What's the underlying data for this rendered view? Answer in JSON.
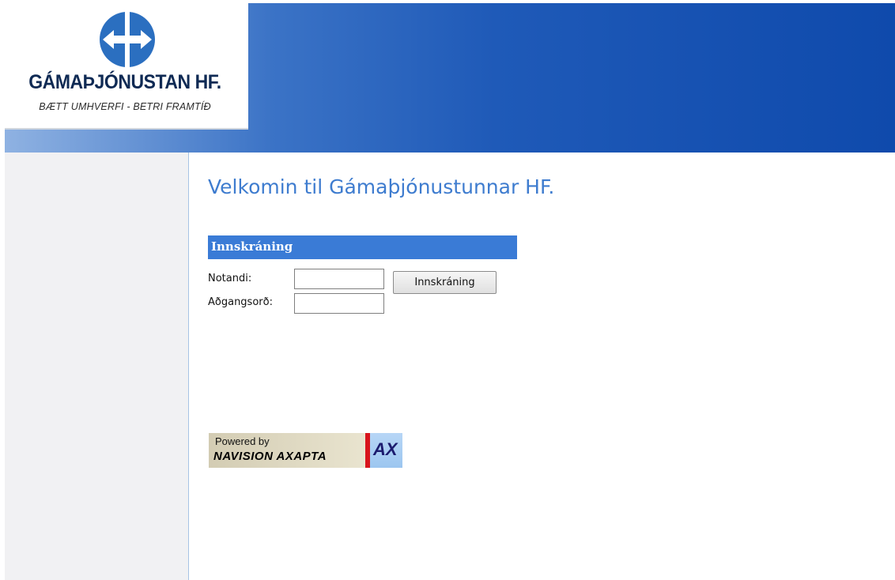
{
  "header": {
    "company_name": "GÁMAÞJÓNUSTAN HF.",
    "tagline": "BÆTT UMHVERFI - BETRI FRAMTÍÐ",
    "logo_icon": "double-arrow-circle-logo",
    "brand_color": "#1f5ab8"
  },
  "main": {
    "welcome": "Velkomin til Gámaþjónustunnar HF."
  },
  "login": {
    "title": "Innskráning",
    "user_label": "Notandi:",
    "user_value": "",
    "password_label": "Aðgangsorð:",
    "password_value": "",
    "button_label": "Innskráning",
    "accent_color": "#3a7bd6"
  },
  "badge": {
    "powered_by": "Powered by",
    "product": "NAVISION AXAPTA",
    "suffix": "AX"
  }
}
